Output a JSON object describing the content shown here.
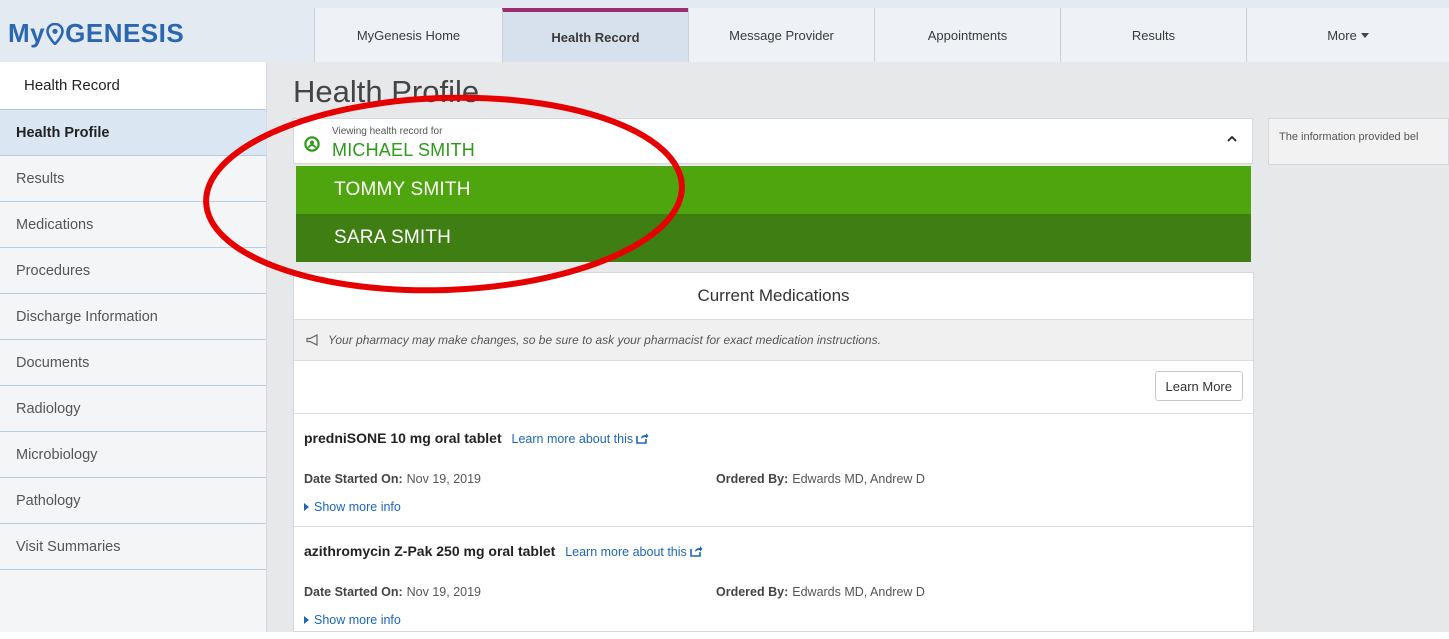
{
  "app": {
    "logo_prefix": "My",
    "logo_suffix": "GENESIS"
  },
  "nav": {
    "items": [
      {
        "label": "MyGenesis Home"
      },
      {
        "label": "Health Record"
      },
      {
        "label": "Message Provider"
      },
      {
        "label": "Appointments"
      },
      {
        "label": "Results"
      },
      {
        "label": "More"
      }
    ],
    "active_index": 1
  },
  "sidebar": {
    "header": "Health Record",
    "items": [
      {
        "label": "Health Profile"
      },
      {
        "label": "Results"
      },
      {
        "label": "Medications"
      },
      {
        "label": "Procedures"
      },
      {
        "label": "Discharge Information"
      },
      {
        "label": "Documents"
      },
      {
        "label": "Radiology"
      },
      {
        "label": "Microbiology"
      },
      {
        "label": "Pathology"
      },
      {
        "label": "Visit Summaries"
      }
    ],
    "active_index": 0
  },
  "main": {
    "title": "Health Profile",
    "selector": {
      "label": "Viewing health record for",
      "current": "MICHAEL SMITH",
      "options": [
        "TOMMY SMITH",
        "SARA SMITH"
      ]
    },
    "info_text": "The information provided bel",
    "medications": {
      "title": "Current Medications",
      "notice": "Your pharmacy may make changes, so be sure to ask your pharmacist for exact medication instructions.",
      "learn_more_button": "Learn More",
      "items": [
        {
          "name": "predniSONE 10 mg oral tablet",
          "link": "Learn more about this",
          "date_label": "Date Started On:",
          "date": "Nov 19, 2019",
          "ordered_label": "Ordered By:",
          "ordered_by": "Edwards MD, Andrew D",
          "show_more": "Show more info"
        },
        {
          "name": "azithromycin Z-Pak 250 mg oral tablet",
          "link": "Learn more about this",
          "date_label": "Date Started On:",
          "date": "Nov 19, 2019",
          "ordered_label": "Ordered By:",
          "ordered_by": "Edwards MD, Andrew D",
          "show_more": "Show more info"
        }
      ]
    }
  },
  "colors": {
    "brand_blue": "#2b66b1",
    "active_tab_accent": "#9c2d6e",
    "green_name": "#2d9a19",
    "option_green_light": "#4fa50d",
    "option_green_dark": "#3f7e12",
    "annotation_red": "#e60000"
  }
}
